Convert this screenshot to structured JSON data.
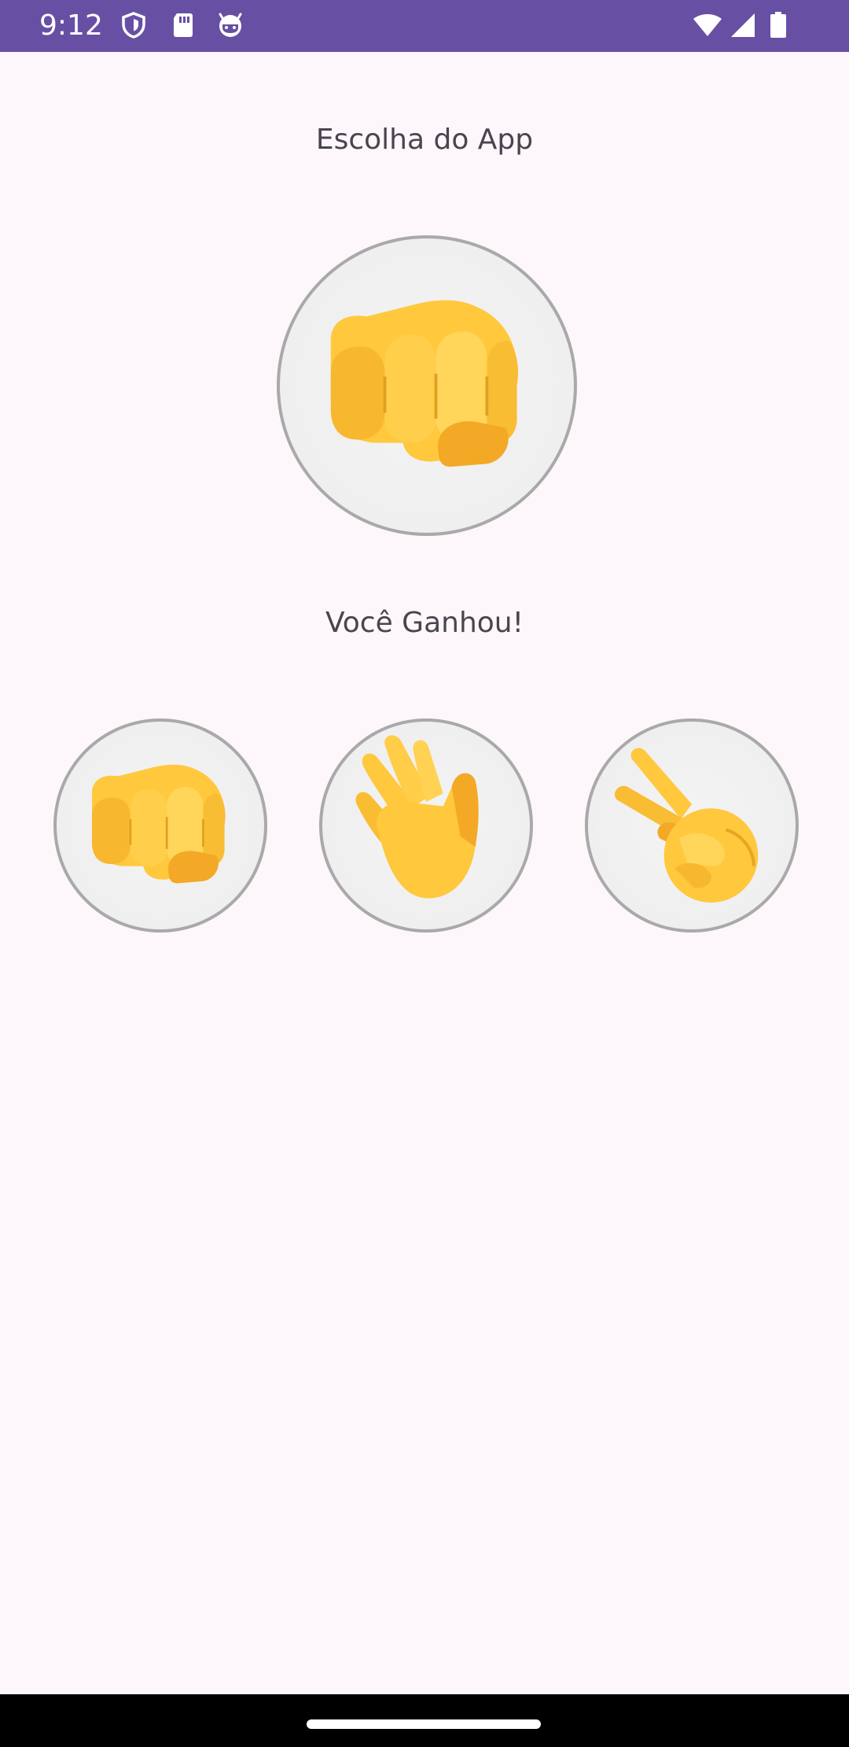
{
  "status_bar": {
    "time": "9:12",
    "background": "#6750a4",
    "left_icons": [
      "shield-icon",
      "sd-card-icon",
      "android-face-icon"
    ],
    "right_icons": [
      "wifi-icon",
      "signal-icon",
      "battery-icon"
    ]
  },
  "app": {
    "choice_heading": "Escolha do App",
    "app_choice_icon": "fist-icon",
    "result_text": "Você Ganhou!",
    "options": [
      {
        "name": "rock",
        "icon": "fist-icon"
      },
      {
        "name": "paper",
        "icon": "open-hand-icon"
      },
      {
        "name": "scissors",
        "icon": "victory-hand-icon"
      }
    ]
  },
  "colors": {
    "background": "#fdf7fc",
    "text": "#49454f",
    "emoji_yellow": "#ffc83d"
  }
}
